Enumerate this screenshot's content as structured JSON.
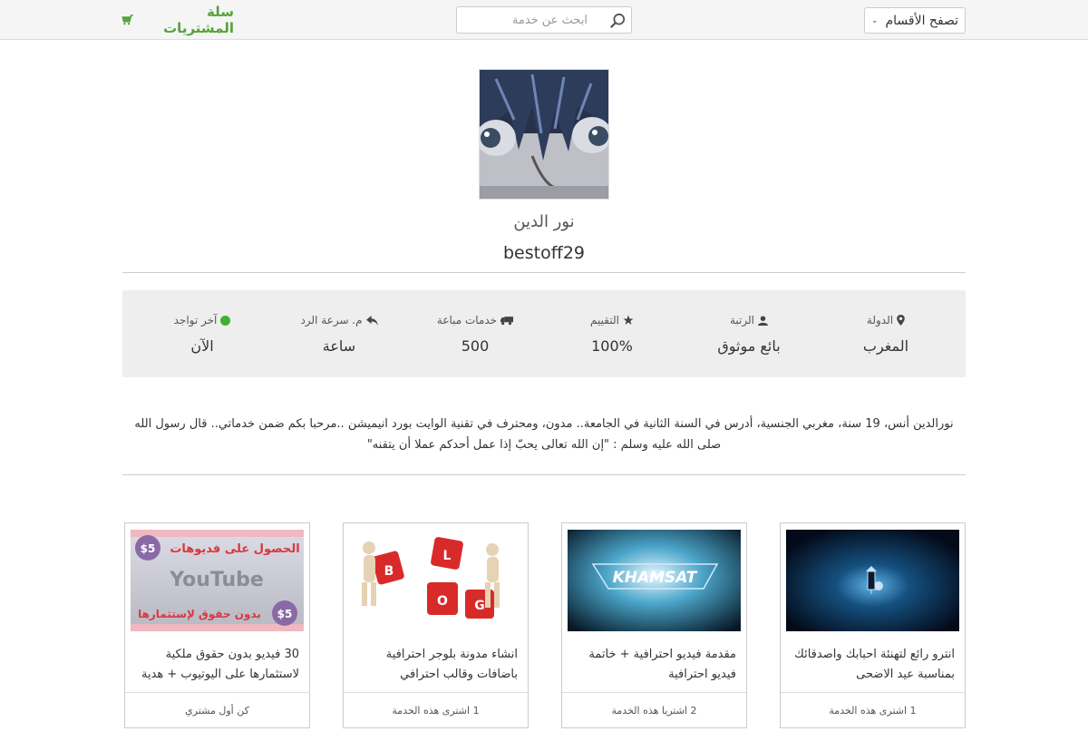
{
  "header": {
    "browse_label": "تصفح الأقسام",
    "search_placeholder": "ابحث عن خدمة",
    "cart_label": "سلة المشتريات"
  },
  "profile": {
    "full_name": "نور الدين",
    "username": "bestoff29"
  },
  "stats": [
    {
      "label": "الدولة",
      "value": "المغرب",
      "icon": "map-marker-icon"
    },
    {
      "label": "الرتبة",
      "value": "بائع موثوق",
      "icon": "user-icon"
    },
    {
      "label": "التقييم",
      "value": "100%",
      "icon": "star-icon"
    },
    {
      "label": "خدمات مباعة",
      "value": "500",
      "icon": "truck-icon"
    },
    {
      "label": "م. سرعة الرد",
      "value": "ساعة",
      "icon": "reply-icon"
    },
    {
      "label": "آخر تواجد",
      "value": "الآن",
      "icon": "online-dot-icon"
    }
  ],
  "bio": {
    "line1": "نورالدين أنس، 19 سنة، مغربي الجنسية، أدرس في السنة الثانية في الجامعة.. مدون، ومحترف في تقنية الوايت بورد انيميشن ..مرحبا بكم ضمن خدماتي.. قال رسول الله",
    "line2": "صلى الله عليه وسلم : \"إن الله تعالى يحبّ إذا عمل أحدكم عملا أن يتقنه\""
  },
  "services": [
    {
      "title": "انترو رائع لتهنئة احبابك واصدقائك بمناسبة عيد الاضحى",
      "footer": "1 اشترى هذه الخدمة"
    },
    {
      "title": "مقدمة فيديو احترافية + خاتمة فيديو احترافية",
      "footer": "2 اشتريا هذه الخدمة",
      "thumb_text": "KHAMSAT"
    },
    {
      "title": "انشاء مدونة بلوجر احترافية باضافات وقالب احترافي",
      "footer": "1 اشترى هذه الخدمة",
      "thumb_letters": [
        "B",
        "L",
        "O",
        "G"
      ]
    },
    {
      "title": "30 فيديو بدون حقوق ملكية لاستثمارها على اليوتيوب + هدية",
      "footer": "كن أول مشتري",
      "thumb_top": "الحصول على فديوهات",
      "thumb_mid": "YouTube",
      "thumb_bottom": "بدون حقوق لإستثمارها",
      "thumb_price": "$5"
    }
  ],
  "colors": {
    "brand_green": "#53a33a",
    "online_dot": "#3eb137",
    "stats_bg": "#eeeeee"
  }
}
